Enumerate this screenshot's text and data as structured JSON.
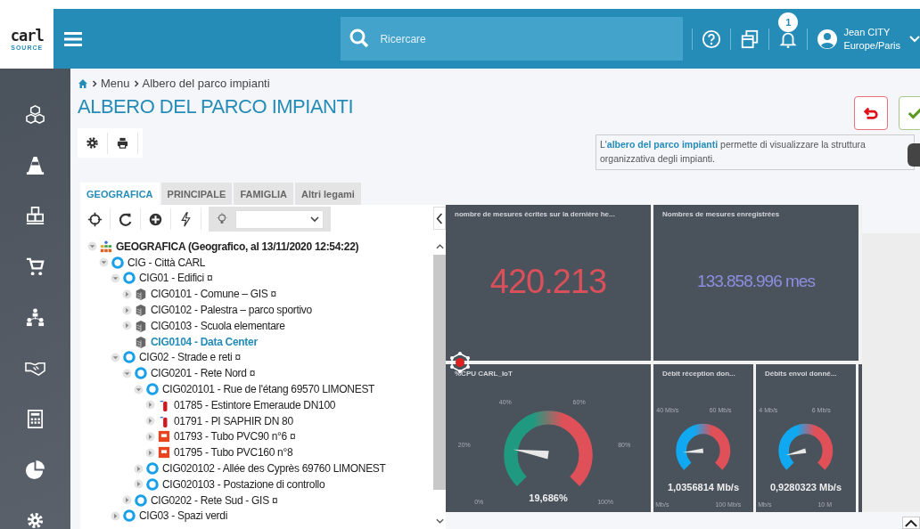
{
  "logo": {
    "name": "carl",
    "tagline": "SOURCE"
  },
  "header": {
    "search_placeholder": "Ricercare",
    "notifications": "1",
    "user": {
      "name": "Jean CITY",
      "timezone": "Europe/Paris"
    }
  },
  "breadcrumb": [
    "Menu",
    "Albero del parco impianti"
  ],
  "title": "ALBERO DEL PARCO IMPIANTI",
  "info": "L'**albero del parco impianti** permette di visualizzare la struttura organizzativa degli impianti.",
  "tabs": [
    {
      "label": "GEOGRAFICA",
      "selected": true
    },
    {
      "label": "PRINCIPALE",
      "selected": false
    },
    {
      "label": "FAMIGLIA",
      "selected": false
    },
    {
      "label": "Altri legami",
      "selected": false
    }
  ],
  "tree": [
    {
      "label": "GEOGRAFICA (Geografico, al 13/11/2020 12:54:22)",
      "kind": "root",
      "expanded": true,
      "selected": false,
      "children": [
        {
          "label": "CIG - Città CARL",
          "kind": "site",
          "expanded": true,
          "selected": false,
          "children": [
            {
              "label": "CIG01 - Edifici ¤",
              "kind": "site",
              "expanded": true,
              "selected": false,
              "children": [
                {
                  "label": "CIG0101 - Comune – GIS ¤",
                  "kind": "building",
                  "expanded": false,
                  "selected": false
                },
                {
                  "label": "CIG0102 - Palestra – parco sportivo",
                  "kind": "building",
                  "expanded": false,
                  "selected": false
                },
                {
                  "label": "CIG0103 - Scuola elementare",
                  "kind": "building",
                  "expanded": false,
                  "selected": false
                },
                {
                  "label": "CIG0104 - Data Center",
                  "kind": "building",
                  "selected": true
                }
              ]
            },
            {
              "label": "CIG02 - Strade e reti ¤",
              "kind": "site",
              "expanded": true,
              "selected": false,
              "children": [
                {
                  "label": "CIG0201 - Rete Nord ¤",
                  "kind": "site",
                  "expanded": true,
                  "selected": false,
                  "children": [
                    {
                      "label": "CIG020101 - Rue de l'étang 69570 LIMONEST",
                      "kind": "site",
                      "expanded": true,
                      "selected": false,
                      "children": [
                        {
                          "label": "01785 - Estintore Emeraude DN100",
                          "kind": "extinguisher",
                          "expanded": false,
                          "selected": false
                        },
                        {
                          "label": "01791 - PI SAPHIR DN 80",
                          "kind": "extinguisher",
                          "expanded": false,
                          "selected": false
                        },
                        {
                          "label": "01793 - Tubo PVC90 n°6 ¤",
                          "kind": "pipe",
                          "expanded": false,
                          "selected": false
                        },
                        {
                          "label": "01795 - Tubo PVC160 n°8",
                          "kind": "pipe",
                          "expanded": false,
                          "selected": false
                        }
                      ]
                    },
                    {
                      "label": "CIG020102 - Allée des Cyprès 69760 LIMONEST",
                      "kind": "site",
                      "expanded": false,
                      "selected": false
                    },
                    {
                      "label": "CIG020103 - Postazione di controllo",
                      "kind": "site",
                      "expanded": false,
                      "selected": false
                    }
                  ]
                },
                {
                  "label": "CIG0202 - Rete Sud - GIS ¤",
                  "kind": "site",
                  "expanded": false,
                  "selected": false
                }
              ]
            },
            {
              "label": "CIG03 - Spazi verdi",
              "kind": "site",
              "expanded": false,
              "selected": false
            }
          ]
        }
      ]
    }
  ],
  "dashboard": {
    "top": [
      {
        "title": "nombre de mesures écrites sur la dernière he...",
        "value": "420.213",
        "color": "#d9505a"
      },
      {
        "title": "Nombres de mesures enregistrées",
        "value": "133.858.996 mes",
        "color": "#8c8fe0"
      }
    ],
    "gauges": [
      {
        "title": "%CPU CARL_IoT",
        "value": "19,686%",
        "kind": "green",
        "ticks": [
          "40%",
          "60%",
          "20%",
          "80%",
          "0%",
          "100%"
        ]
      },
      {
        "title": "Débit réception don...",
        "value": "1,0356814 Mb/s",
        "kind": "blue",
        "ticks": [
          "40 Mb/s",
          "60 Mb/s",
          "Mb/s",
          "100 Mb/s"
        ]
      },
      {
        "title": "Débits envoi donné...",
        "value": "0,9280323 Mb/s",
        "kind": "blue",
        "ticks": [
          "4 Mb/s",
          "6 Mb/s",
          "Mb/s",
          "10 M"
        ]
      }
    ]
  }
}
